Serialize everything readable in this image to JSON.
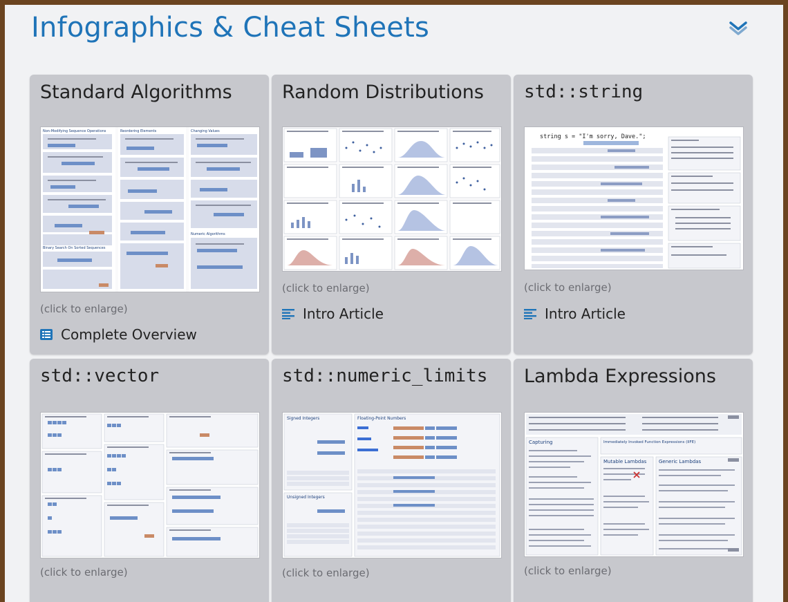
{
  "section": {
    "title": "Infographics & Cheat Sheets",
    "collapse_icon": "chevron-double-down-icon"
  },
  "accent_color": "#1f74b8",
  "cards": [
    {
      "title": "Standard Algorithms",
      "hint": "(click to enlarge)",
      "link": "Complete Overview",
      "link_icon": "table-list-icon",
      "thumb_headers": [
        "Non-Modifying Sequence Operations",
        "Reordering Elements",
        "Changing Values",
        "Binary Search On Sorted Sequences",
        "Numeric Algorithms"
      ]
    },
    {
      "title": "Random Distributions",
      "hint": "(click to enlarge)",
      "link": "Intro Article",
      "link_icon": "article-lines-icon"
    },
    {
      "title": "std::string",
      "hint": "(click to enlarge)",
      "link": "Intro Article",
      "link_icon": "article-lines-icon",
      "thumb_code": "string s = \"I'm sorry, Dave.\";"
    },
    {
      "title": "std::vector",
      "hint": "(click to enlarge)"
    },
    {
      "title": "std::numeric_limits",
      "hint": "(click to enlarge)",
      "thumb_headers": [
        "Signed Integers",
        "Floating-Point Numbers",
        "Unsigned Integers"
      ]
    },
    {
      "title": "Lambda Expressions",
      "hint": "(click to enlarge)",
      "thumb_headers": [
        "Capturing",
        "Immediately Invoked Function Expressions (IIFE)",
        "Mutable Lambdas",
        "Generic Lambdas"
      ]
    }
  ]
}
